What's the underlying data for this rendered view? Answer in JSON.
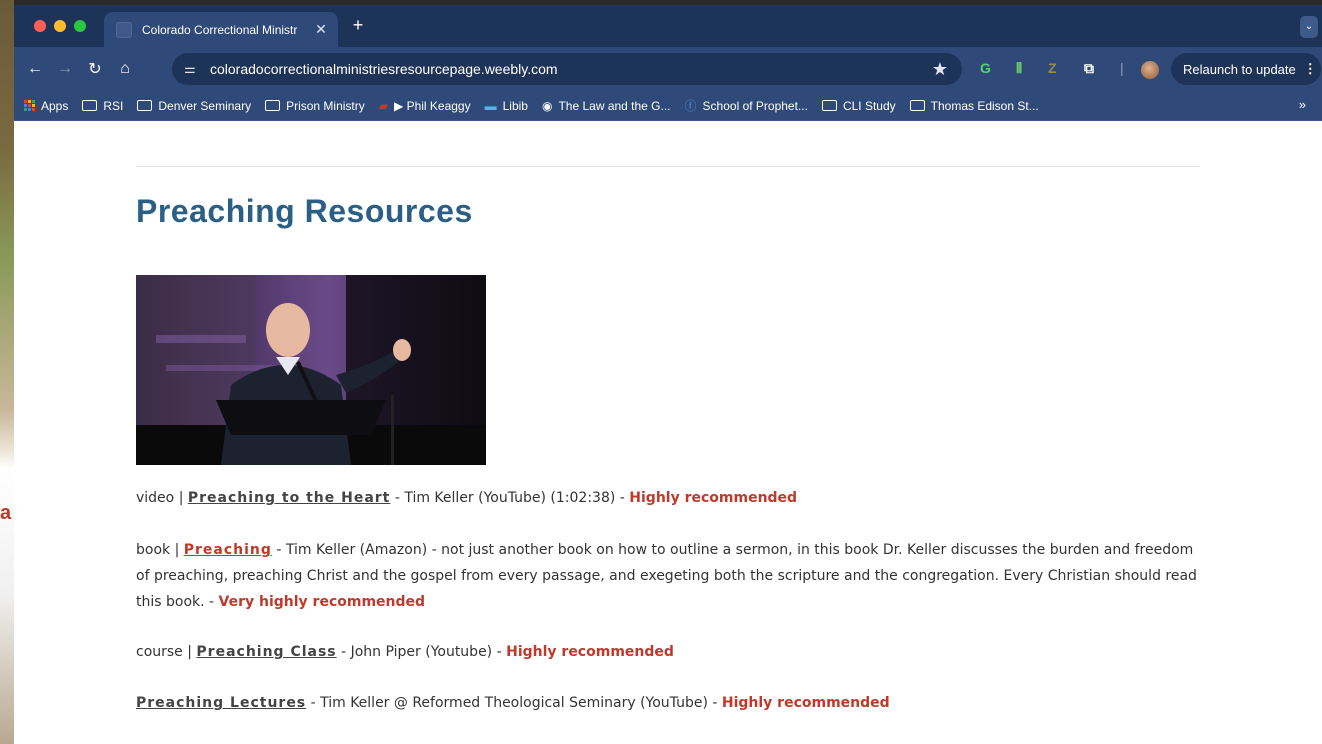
{
  "browser": {
    "tab_title": "Colorado Correctional Ministr",
    "tab_close": "✕",
    "new_tab": "+",
    "url": "coloradocorrectionalministriesresourcepage.weebly.com",
    "relaunch_label": "Relaunch to update",
    "bookmarks_more": "»",
    "bookmarks": [
      {
        "label": "Apps"
      },
      {
        "label": "RSI"
      },
      {
        "label": "Denver Seminary"
      },
      {
        "label": "Prison Ministry"
      },
      {
        "label": "▶ Phil Keaggy"
      },
      {
        "label": "Libib"
      },
      {
        "label": "The Law and the G..."
      },
      {
        "label": "School of Prophet..."
      },
      {
        "label": "CLI Study"
      },
      {
        "label": "Thomas Edison St..."
      }
    ]
  },
  "page": {
    "heading": "Preaching Resources",
    "items": [
      {
        "prefix": "video | ",
        "link": "Preaching to the Heart",
        "desc": " - Tim Keller (YouTube) (1:02:38) - ",
        "rec": "Highly recommended"
      },
      {
        "prefix": "book | ",
        "link": "Preaching",
        "desc": " - Tim Keller  (Amazon) - not just another book on how to outline a sermon, in this book Dr. Keller discusses the burden and freedom of preaching, preaching Christ and the gospel from every passage, and exegeting both the scripture and the congregation. Every Christian should read this book. - ",
        "rec": "Very highly recommended"
      },
      {
        "prefix": "course | ",
        "link": "Preaching Class",
        "desc": " - John Piper (Youtube) - ",
        "rec": "Highly recommended"
      },
      {
        "prefix": "",
        "link": "Preaching Lectures",
        "desc": " - Tim Keller @ Reformed Theological Seminary (YouTube) - ",
        "rec": "Highly recommended"
      }
    ]
  },
  "colors": {
    "heading": "#2b5f86",
    "recommend": "#c0392b",
    "chrome_dark": "#1e3358",
    "chrome": "#2f4a78"
  }
}
